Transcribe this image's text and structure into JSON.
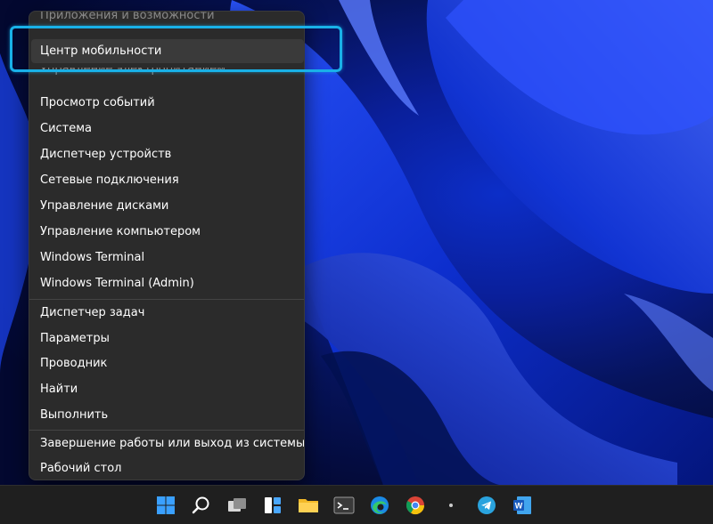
{
  "menu": {
    "items": [
      {
        "label": "Приложения и возможности",
        "faded": true
      },
      {
        "label": "Центр мобильности",
        "selected": true
      },
      {
        "label": "Управление электропитанием",
        "faded": true
      },
      {
        "label": "Просмотр событий"
      },
      {
        "label": "Система"
      },
      {
        "label": "Диспетчер устройств"
      },
      {
        "label": "Сетевые подключения"
      },
      {
        "label": "Управление дисками"
      },
      {
        "label": "Управление компьютером"
      },
      {
        "label": "Windows Terminal"
      },
      {
        "label": "Windows Terminal (Admin)"
      },
      {
        "label": "Диспетчер задач"
      },
      {
        "label": "Параметры"
      },
      {
        "label": "Проводник"
      },
      {
        "label": "Найти"
      },
      {
        "label": "Выполнить"
      },
      {
        "label": "Завершение работы или выход из системы",
        "submenu_indicator": "›"
      },
      {
        "label": "Рабочий стол"
      }
    ]
  },
  "taskbar": {
    "icons": [
      "windows-start-icon",
      "search-icon",
      "task-view-icon",
      "widgets-icon",
      "file-explorer-icon",
      "terminal-icon",
      "edge-icon",
      "chrome-icon",
      "telegram-icon",
      "word-icon"
    ]
  },
  "colors": {
    "highlight": "#19b1e8",
    "menu_bg": "#2b2b2b",
    "taskbar_bg": "#1f1f1f"
  }
}
